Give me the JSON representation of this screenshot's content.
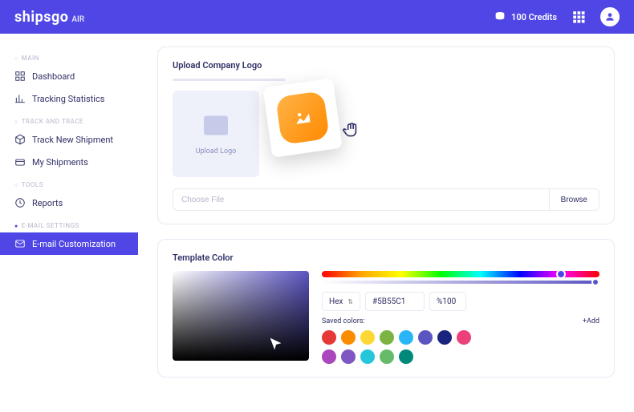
{
  "brand": {
    "name": "shipsgo",
    "suffix": "AIR"
  },
  "header": {
    "credits_label": "100 Credits"
  },
  "sidebar": {
    "sections": [
      {
        "label": "MAIN",
        "active": false
      },
      {
        "label": "TRACK AND TRACE",
        "active": false
      },
      {
        "label": "TOOLS",
        "active": false
      },
      {
        "label": "E-MAIL SETTINGS",
        "active": true
      }
    ],
    "items": {
      "dashboard": "Dashboard",
      "tracking_stats": "Tracking Statistics",
      "track_new": "Track New Shipment",
      "my_shipments": "My Shipments",
      "reports": "Reports",
      "email_customization": "E-mail Customization"
    }
  },
  "upload": {
    "title": "Upload Company Logo",
    "box_label": "Upload Logo",
    "placeholder": "Choose File",
    "browse": "Browse"
  },
  "color": {
    "title": "Template Color",
    "format": "Hex",
    "hex": "#5B55C1",
    "alpha": "%100",
    "saved_label": "Saved colors:",
    "add_label": "+Add",
    "swatches": [
      "#e53935",
      "#fb8c00",
      "#fdd835",
      "#7cb342",
      "#29b6f6",
      "#5b55c1",
      "#1a237e",
      "#ec407a",
      "#ab47bc",
      "#7e57c2",
      "#26c6da",
      "#66bb6a",
      "#00897b"
    ]
  }
}
